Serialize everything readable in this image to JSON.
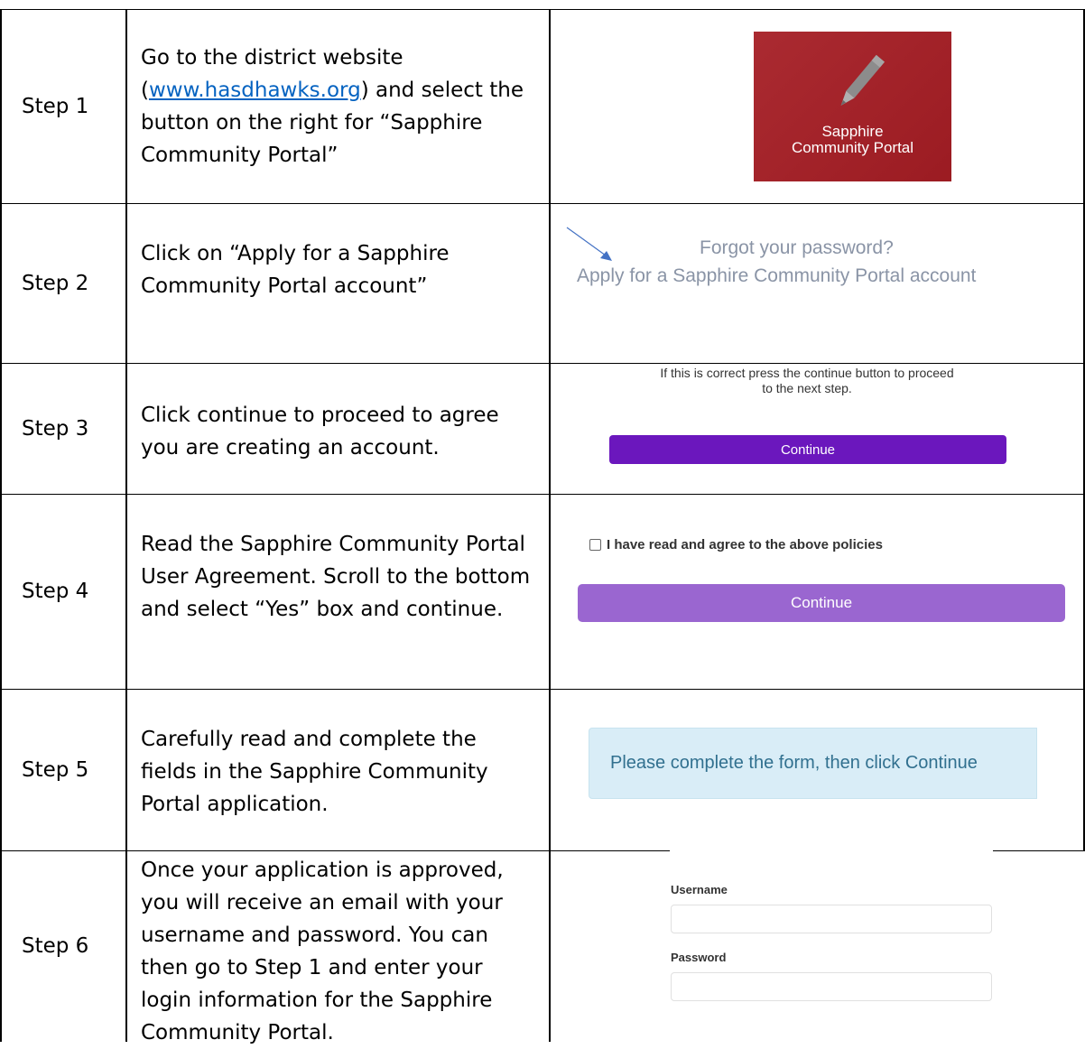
{
  "steps": [
    {
      "label": "Step 1",
      "desc_before": "Go to the district website (",
      "link": "www.hasdhawks.org",
      "desc_after": ") and select the button on the right for “Sapphire Community Portal”"
    },
    {
      "label": "Step 2",
      "desc": "Click on “Apply for a Sapphire Community Portal account”"
    },
    {
      "label": "Step 3",
      "desc": "Click continue to proceed to agree you are creating an account."
    },
    {
      "label": "Step 4",
      "desc": "Read the Sapphire Community Portal User Agreement. Scroll to the bottom and select “Yes” box and continue."
    },
    {
      "label": "Step 5",
      "desc": "Carefully read and complete the fields in the Sapphire Community Portal application."
    },
    {
      "label": "Step 6",
      "desc": "Once your application is approved, you will receive an email with your username and password. You can then go to Step 1 and enter your login information for the Sapphire Community Portal."
    }
  ],
  "step1_shot": {
    "line1": "Sapphire",
    "line2": "Community Portal",
    "icon": "pencil-icon",
    "bg_color": "#a51d24"
  },
  "step2_shot": {
    "forgot": "Forgot your password?",
    "apply": "Apply for a Sapphire Community Portal account",
    "icon": "arrow-icon"
  },
  "step3_shot": {
    "notice_line1": "If this is correct press the continue button to proceed",
    "notice_line2": "to the next step.",
    "button": "Continue",
    "button_color": "#6b17bd"
  },
  "step4_shot": {
    "checkbox_label": "I have read and agree to the above policies",
    "button": "Continue",
    "button_color": "#9a66d0"
  },
  "step5_shot": {
    "message": "Please complete the form, then click Continue"
  },
  "step6_shot": {
    "username_label": "Username",
    "password_label": "Password"
  }
}
